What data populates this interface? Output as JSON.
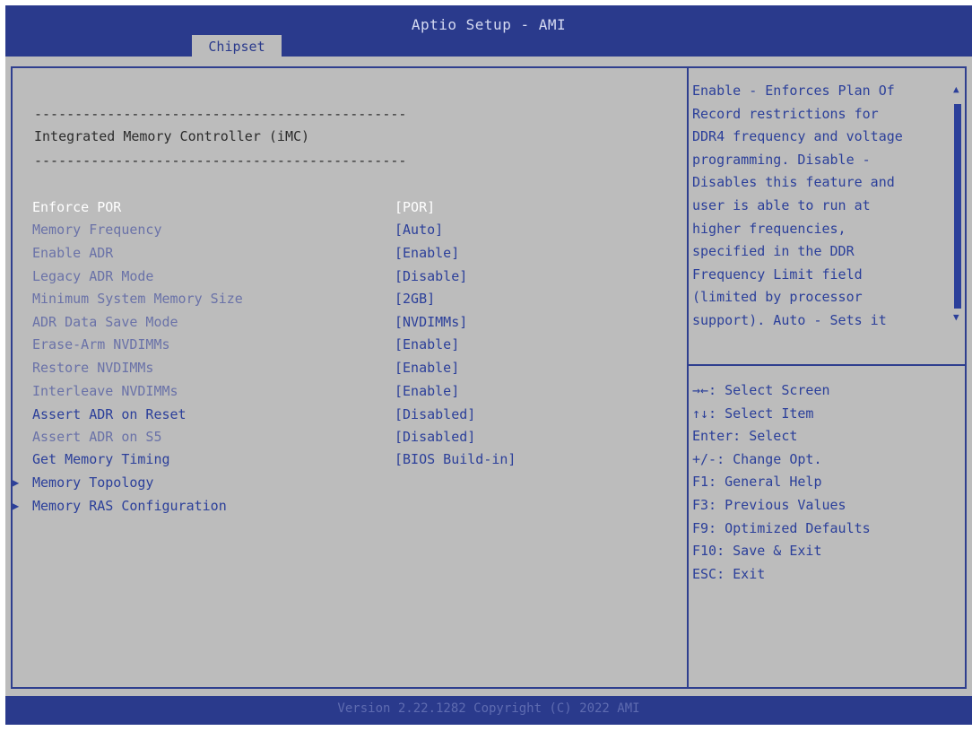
{
  "app_title": "Aptio Setup - AMI",
  "tabs": [
    {
      "label": "Chipset",
      "active": true
    }
  ],
  "section": {
    "divider": "----------------------------------------------",
    "title": "Integrated Memory Controller (iMC)"
  },
  "settings": [
    {
      "label": "Enforce POR",
      "value": "[POR]",
      "state": "selected"
    },
    {
      "label": "Memory Frequency",
      "value": "[Auto]",
      "state": "dim"
    },
    {
      "label": "Enable ADR",
      "value": "[Enable]",
      "state": "dim"
    },
    {
      "label": "Legacy ADR Mode",
      "value": "[Disable]",
      "state": "dim"
    },
    {
      "label": "Minimum System Memory Size",
      "value": "[2GB]",
      "state": "dim"
    },
    {
      "label": "ADR Data Save Mode",
      "value": "[NVDIMMs]",
      "state": "dim"
    },
    {
      "label": "Erase-Arm NVDIMMs",
      "value": "[Enable]",
      "state": "dim"
    },
    {
      "label": "Restore NVDIMMs",
      "value": "[Enable]",
      "state": "dim"
    },
    {
      "label": "Interleave NVDIMMs",
      "value": "[Enable]",
      "state": "dim"
    },
    {
      "label": "Assert ADR on Reset",
      "value": "[Disabled]",
      "state": "normal"
    },
    {
      "label": "Assert ADR on S5",
      "value": "[Disabled]",
      "state": "dim"
    },
    {
      "label": "Get Memory Timing",
      "value": "[BIOS Build-in]",
      "state": "normal"
    }
  ],
  "submenus": [
    {
      "label": "Memory Topology"
    },
    {
      "label": "Memory RAS Configuration"
    }
  ],
  "help": {
    "lines": [
      "Enable - Enforces Plan Of",
      "Record restrictions for",
      "DDR4 frequency and voltage",
      "programming. Disable -",
      "Disables this feature and",
      "user is able to run at",
      "higher frequencies,",
      "specified in the DDR",
      "Frequency Limit field",
      "(limited by processor",
      "support). Auto - Sets it"
    ]
  },
  "keys": [
    "→←: Select Screen",
    "↑↓: Select Item",
    "Enter: Select",
    "+/-: Change Opt.",
    "F1: General Help",
    "F3: Previous Values",
    "F9: Optimized Defaults",
    "F10: Save & Exit",
    "ESC: Exit"
  ],
  "footer": "Version 2.22.1282 Copyright (C) 2022 AMI",
  "colors": {
    "header_bg": "#2a3a8c",
    "body_bg": "#bcbcbc",
    "text_blue": "#2b3f9a",
    "selected": "#ffffff"
  }
}
